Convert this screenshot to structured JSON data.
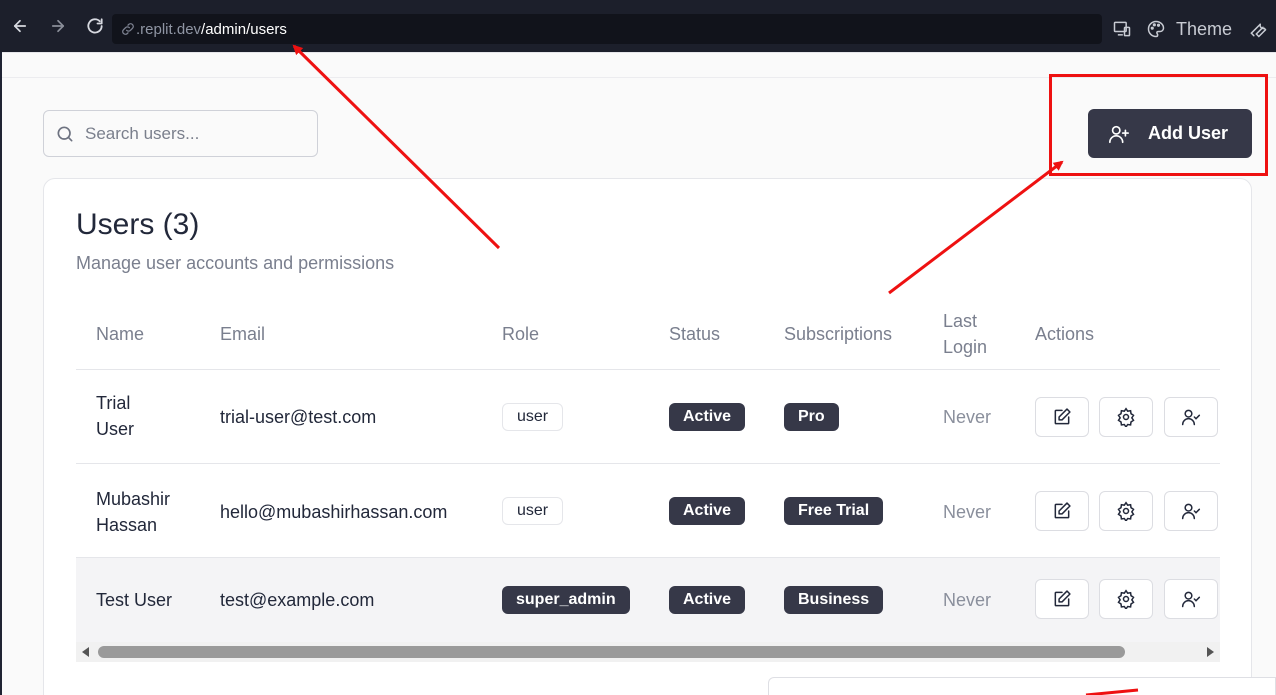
{
  "browser": {
    "url_domain": ".replit.dev",
    "url_path": "/admin/users",
    "theme_label": "Theme"
  },
  "search": {
    "placeholder": "Search users..."
  },
  "add_user_button": {
    "label": "Add User"
  },
  "card": {
    "title": "Users (3)",
    "subtitle": "Manage user accounts and permissions"
  },
  "table": {
    "headers": {
      "name": "Name",
      "email": "Email",
      "role": "Role",
      "status": "Status",
      "subscriptions": "Subscriptions",
      "last_login_1": "Last",
      "last_login_2": "Login",
      "actions": "Actions"
    },
    "rows": [
      {
        "name_1": "Trial",
        "name_2": "User",
        "email": "trial-user@test.com",
        "role": "user",
        "status": "Active",
        "subscription": "Pro",
        "last_login": "Never"
      },
      {
        "name_1": "Mubashir",
        "name_2": "Hassan",
        "email": "hello@mubashirhassan.com",
        "role": "user",
        "status": "Active",
        "subscription": "Free Trial",
        "last_login": "Never"
      },
      {
        "name_1": "Test User",
        "email": "test@example.com",
        "role": "super_admin",
        "status": "Active",
        "subscription": "Business",
        "last_login": "Never"
      }
    ]
  },
  "colors": {
    "accent_dark": "#363848",
    "annotation_red": "#ee1111",
    "chrome_bg": "#1c1f2b"
  },
  "icons": [
    "back-arrow-icon",
    "forward-arrow-icon",
    "reload-icon",
    "link-icon",
    "devices-icon",
    "palette-icon",
    "wrench-icon",
    "search-icon",
    "user-plus-icon",
    "edit-icon",
    "settings-icon",
    "user-check-icon"
  ]
}
